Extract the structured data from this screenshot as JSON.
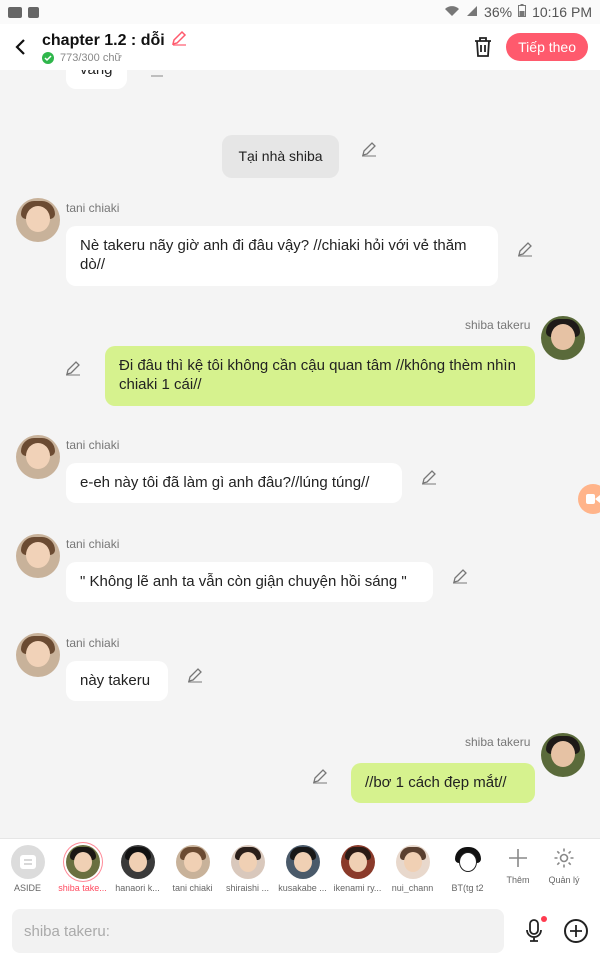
{
  "status": {
    "battery": "36%",
    "time": "10:16 PM"
  },
  "header": {
    "title": "chapter 1.2 : dỗi",
    "word_count": "773/300 chữ",
    "next_label": "Tiếp theo"
  },
  "chat": {
    "partial_top": "vàng",
    "scene": "Tại nhà shiba",
    "messages": [
      {
        "name": "tani chiaki",
        "text": "Nè takeru nãy giờ anh đi đâu vậy? //chiaki hỏi với vẻ thăm dò//"
      },
      {
        "name": "shiba takeru",
        "text": "Đi đâu thì kệ tôi không cần cậu quan tâm //không thèm nhìn chiaki 1 cái//"
      },
      {
        "name": "tani chiaki",
        "text": "e-eh này tôi đã làm gì anh đâu?//lúng túng//"
      },
      {
        "name": "tani chiaki",
        "text": "\" Không lẽ anh ta vẫn còn giận chuyện hồi sáng \""
      },
      {
        "name": "tani chiaki",
        "text": "này takeru"
      },
      {
        "name": "shiba takeru",
        "text": "//bơ 1 cách đẹp mắt//"
      }
    ]
  },
  "characters": [
    {
      "label": "ASIDE"
    },
    {
      "label": "shiba take..."
    },
    {
      "label": "hanaori k..."
    },
    {
      "label": "tani chiaki"
    },
    {
      "label": "shiraishi ..."
    },
    {
      "label": "kusakabe ..."
    },
    {
      "label": "ikenami ry..."
    },
    {
      "label": "nui_chann"
    },
    {
      "label": "BT(tg t2"
    }
  ],
  "utilities": {
    "add_label": "Thêm",
    "manage_label": "Quản lý"
  },
  "input": {
    "placeholder": "shiba takeru:"
  },
  "colors": {
    "accent": "#ff5a6d",
    "self_bubble": "#d6f28e",
    "other_bubble": "#ffffff"
  }
}
